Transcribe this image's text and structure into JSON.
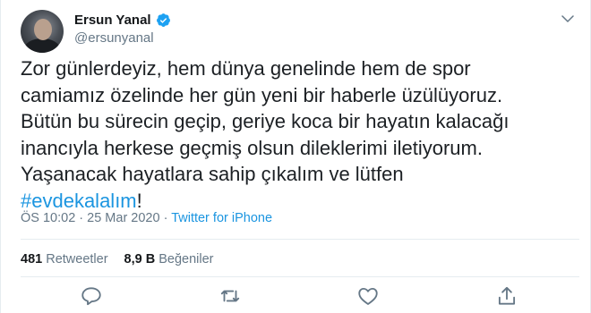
{
  "author": {
    "name": "Ersun Yanal",
    "handle": "@ersunyanal",
    "verified": true
  },
  "tweet": {
    "lines": [
      "Zor günlerdeyiz, hem dünya genelinde hem de spor",
      "camiamız özelinde her gün yeni bir haberle üzülüyoruz.",
      "Bütün bu sürecin geçip, geriye koca bir hayatın kalacağı",
      "inancıyla herkese geçmiş olsun dileklerimi iletiyorum.",
      "Yaşanacak hayatlara sahip çıkalım ve lütfen"
    ],
    "hashtag": "#evdekalalım",
    "trailing": "!"
  },
  "meta": {
    "timestamp": "ÖS 10:02 · 25 Mar 2020 · ",
    "source": "Twitter for iPhone"
  },
  "stats": {
    "retweets_count": "481",
    "retweets_label": " Retweetler",
    "likes_count": "8,9 B",
    "likes_label": " Beğeniler"
  },
  "colors": {
    "accent": "#1b95e0",
    "muted": "#657786",
    "divider": "#e6ecf0"
  },
  "icons": [
    "chevron-down-icon",
    "verified-badge-icon",
    "reply-icon",
    "retweet-icon",
    "like-icon",
    "share-icon"
  ]
}
